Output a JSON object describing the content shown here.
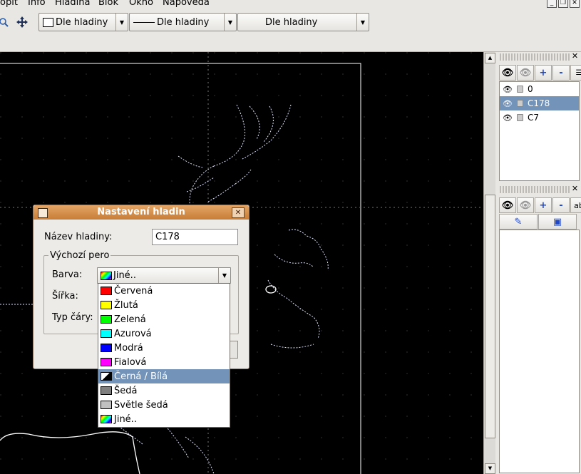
{
  "menu": [
    "opit",
    "Info",
    "Hladina",
    "Blok",
    "Okno",
    "Napoveda"
  ],
  "toolbar": {
    "combo_color": "Dle hladiny",
    "combo_width": "Dle hladiny",
    "combo_linetype": "Dle hladiny"
  },
  "layer_panel": {
    "layers": [
      {
        "name": "0",
        "selected": false
      },
      {
        "name": "C178",
        "selected": true
      },
      {
        "name": "C7",
        "selected": false
      }
    ],
    "tool_labels": {
      "add": "+",
      "remove": "-"
    }
  },
  "block_panel": {
    "tool_labels": {
      "add": "+",
      "remove": "-",
      "rename": "ab"
    }
  },
  "dialog": {
    "title": "Nastavení hladin",
    "name_label": "Název hladiny:",
    "name_value": "C178",
    "group_label": "Výchozí pero",
    "color_label": "Barva:",
    "color_value": "Jiné..",
    "width_label": "Šířka:",
    "linetype_label": "Typ čáry:"
  },
  "dropdown": {
    "options": [
      {
        "label": "Červená",
        "color": "#ff0000"
      },
      {
        "label": "Žlutá",
        "color": "#ffff00"
      },
      {
        "label": "Zelená",
        "color": "#00ff00"
      },
      {
        "label": "Azurová",
        "color": "#00ffff"
      },
      {
        "label": "Modrá",
        "color": "#0000ff"
      },
      {
        "label": "Fialová",
        "color": "#ff00ff"
      },
      {
        "label": "Černá / Bílá",
        "color": "black-white",
        "selected": true
      },
      {
        "label": "Šedá",
        "color": "#808080"
      },
      {
        "label": "Světle šedá",
        "color": "#c0c0c0"
      },
      {
        "label": "Jiné..",
        "color": "rainbow"
      }
    ]
  },
  "colors": {
    "selection": "#7393b9",
    "dialog_title": "#c77d37",
    "canvas": "#000000"
  }
}
